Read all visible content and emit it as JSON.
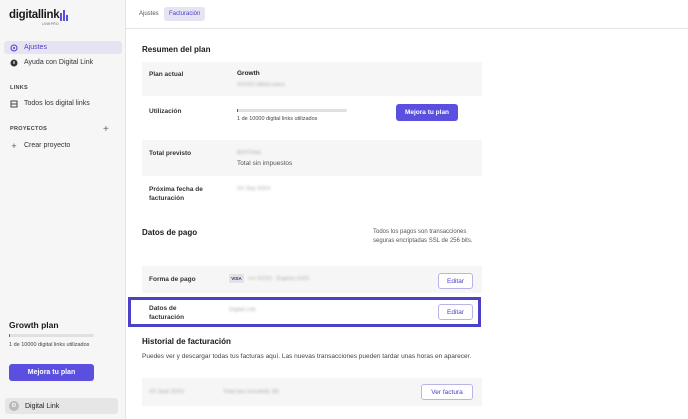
{
  "brand": {
    "logo_text": "digitallink",
    "logo_sub": "LINKPRO",
    "accent_color": "#5b4fe0"
  },
  "sidebar": {
    "items": [
      {
        "label": "Ajustes",
        "icon": "gear-icon"
      },
      {
        "label": "Ayuda con Digital Link",
        "icon": "help-icon"
      }
    ],
    "links_section": "LINKS",
    "links_item": {
      "label": "Todos los digital links",
      "icon": "list-icon"
    },
    "projects_section": "PROYECTOS",
    "create_project": "Crear proyecto",
    "plan": {
      "title": "Growth plan",
      "usage": "1 de 10000 digital links utilizados",
      "progress_fraction": 0.0001,
      "button": "Mejora tu plan"
    },
    "account": {
      "initial": "D",
      "name": "Digital Link"
    }
  },
  "tabs": [
    {
      "label": "Ajustes",
      "active": false
    },
    {
      "label": "Facturación",
      "active": true
    }
  ],
  "plan_summary": {
    "title": "Resumen del plan",
    "current_plan_label": "Plan actual",
    "current_plan_value": "Growth",
    "current_plan_sub": "XXXXX billed users",
    "usage_label": "Utilización",
    "usage_text": "1 de 10000 digital links utilizados",
    "usage_fraction": 0.0001,
    "upgrade_button": "Mejora tu plan",
    "forecast_label": "Total previsto",
    "forecast_value": "$XX/Total",
    "forecast_sub": "Total sin impuestos",
    "next_billing_label": "Próxima fecha de facturación",
    "next_billing_value": "XX Sep 20XX"
  },
  "payment": {
    "title": "Datos de pago",
    "secure_note": "Todos los pagos son transacciones seguras encriptadas SSL de 256 bits.",
    "method_label": "Forma de pago",
    "card_brand": "VISA",
    "card_masked": "•••• XXXX · Expires XX/X",
    "method_button": "Editar",
    "billing_label": "Datos de facturación",
    "billing_value": "Digital Link",
    "billing_button": "Editar"
  },
  "history": {
    "title": "Historial de facturación",
    "description": "Puedes ver y descargar todas tus facturas aquí. Las nuevas transacciones pueden tardar unas horas en aparecer.",
    "rows": [
      {
        "date": "XX Sept 20XX",
        "amount": "Total (tax included): $X",
        "button": "Ver factura"
      }
    ]
  }
}
